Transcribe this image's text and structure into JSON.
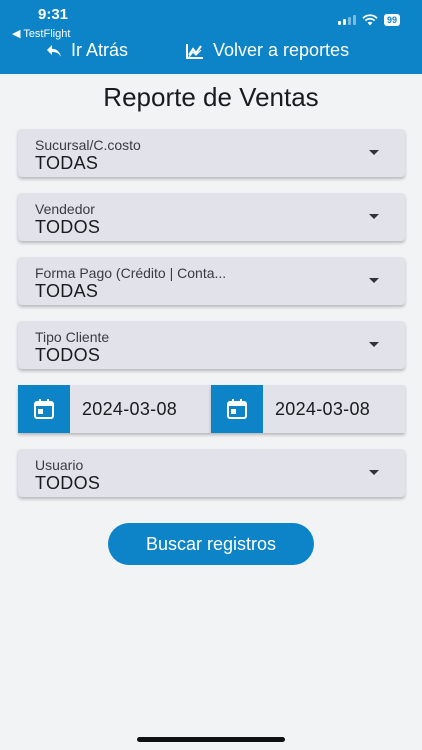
{
  "status_bar": {
    "time": "9:31",
    "back_app": "◀ TestFlight",
    "battery": "99"
  },
  "nav": {
    "back_label": "Ir Atrás",
    "reports_label": "Volver a reportes"
  },
  "title": "Reporte de Ventas",
  "filters": [
    {
      "label": "Sucursal/C.costo",
      "value": "TODAS"
    },
    {
      "label": "Vendedor",
      "value": "TODOS"
    },
    {
      "label": "Forma Pago (Crédito | Conta...",
      "value": "TODAS"
    },
    {
      "label": "Tipo Cliente",
      "value": "TODOS"
    }
  ],
  "dates": {
    "from": "2024-03-08",
    "to": "2024-03-08"
  },
  "user_filter": {
    "label": "Usuario",
    "value": "TODOS"
  },
  "search_button": "Buscar registros",
  "colors": {
    "primary": "#0d84c8",
    "background": "#f2f3f5",
    "field": "#e2e3ea"
  }
}
